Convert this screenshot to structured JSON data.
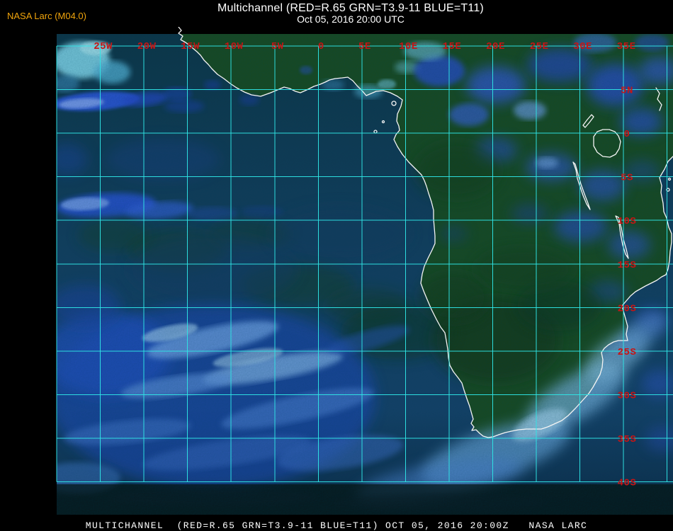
{
  "window": {
    "background": "#000000"
  },
  "header": {
    "title_line1": "Multichannel (RED=R.65 GRN=T3.9-11 BLUE=T11)",
    "title_line2": "Oct 05, 2016 20:00 UTC",
    "credit": "NASA Larc (M04.0)",
    "title_color": "#ffffff",
    "credit_color": "#f0a40c"
  },
  "map": {
    "lon_labels": [
      "25W",
      "20W",
      "15W",
      "10W",
      "5W",
      "0",
      "5E",
      "10E",
      "15E",
      "20E",
      "25E",
      "30E",
      "35E"
    ],
    "lat_labels": [
      "5N",
      "0",
      "5S",
      "10S",
      "15S",
      "20S",
      "25S",
      "30S",
      "35S",
      "40S"
    ],
    "grid_interval_degrees": 5,
    "grid_color": "#2fe6e6",
    "label_color": "#c81414",
    "coastline_color": "#f4f4f4",
    "land_color": "#1a4a1e",
    "ocean_color": "#143e5e",
    "cloud_color": "#2a50c8"
  },
  "footer": {
    "caption": "MULTICHANNEL  (RED=R.65 GRN=T3.9-11 BLUE=T11) OCT 05, 2016 20:00Z   NASA LARC"
  }
}
